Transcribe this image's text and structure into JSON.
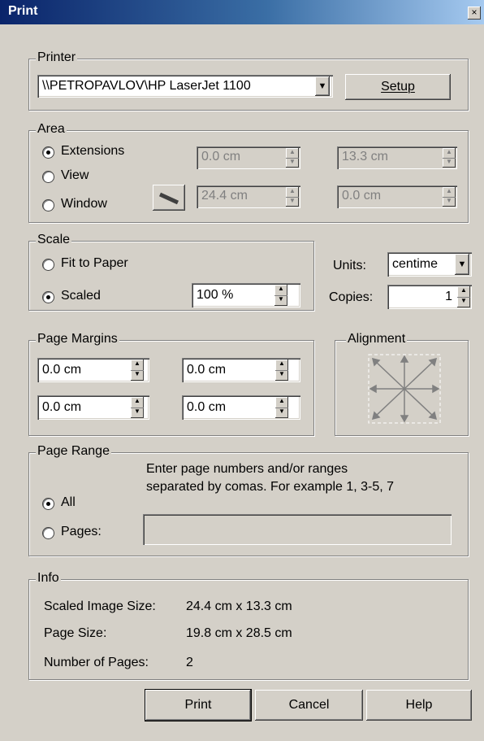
{
  "window": {
    "title": "Print",
    "close_glyph": "×"
  },
  "printer": {
    "group_label": "Printer",
    "selected": "\\\\PETROPAVLOV\\HP LaserJet 1100",
    "setup_label": "Setup"
  },
  "area": {
    "group_label": "Area",
    "options": [
      "Extensions",
      "View",
      "Window"
    ],
    "selected": "Extensions",
    "fields": [
      "0.0 cm",
      "13.3 cm",
      "24.4 cm",
      "0.0 cm"
    ]
  },
  "scale": {
    "group_label": "Scale",
    "options": [
      "Fit to Paper",
      "Scaled"
    ],
    "selected": "Scaled",
    "value": "100 %"
  },
  "units": {
    "label": "Units:",
    "value": "centime"
  },
  "copies": {
    "label": "Copies:",
    "value": "1"
  },
  "margins": {
    "group_label": "Page Margins",
    "values": [
      "0.0 cm",
      "0.0 cm",
      "0.0 cm",
      "0.0 cm"
    ]
  },
  "alignment": {
    "group_label": "Alignment"
  },
  "page_range": {
    "group_label": "Page Range",
    "hint_line1": "Enter page numbers and/or ranges",
    "hint_line2": "separated by comas. For example 1, 3-5, 7",
    "options": [
      "All",
      "Pages:"
    ],
    "selected": "All",
    "pages_value": ""
  },
  "info": {
    "group_label": "Info",
    "rows": [
      {
        "label": "Scaled Image Size:",
        "value": "24.4 cm x 13.3 cm"
      },
      {
        "label": "Page Size:",
        "value": "19.8 cm x 28.5 cm"
      },
      {
        "label": "Number of Pages:",
        "value": "2"
      }
    ]
  },
  "buttons": {
    "print": "Print",
    "cancel": "Cancel",
    "help": "Help"
  }
}
